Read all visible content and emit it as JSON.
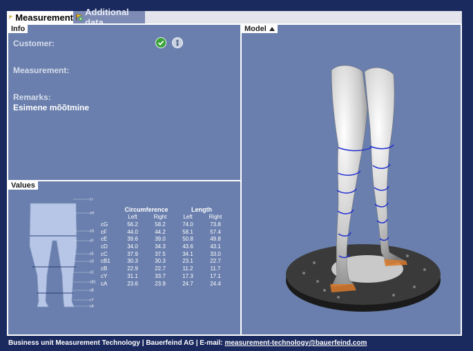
{
  "tabs": [
    {
      "label": "Measurement",
      "active": true,
      "icon": "flag-icon"
    },
    {
      "label": "Additional data",
      "active": false,
      "icon": "plus-icon"
    }
  ],
  "info": {
    "title": "Info",
    "customer_label": "Customer:",
    "measurement_label": "Measurement:",
    "remarks_label": "Remarks:",
    "remarks_value": "Esimene mõõtmine",
    "icons": [
      "check-icon",
      "person-icon"
    ]
  },
  "values": {
    "title": "Values",
    "circumference_label": "Circumference",
    "length_label": "Length",
    "col_left": "Left",
    "col_right": "Right",
    "rows": [
      {
        "m": "cG",
        "cl": "56.2",
        "cr": "58.2",
        "ll": "74.0",
        "lr": "73.8"
      },
      {
        "m": "cF",
        "cl": "44.0",
        "cr": "44.2",
        "ll": "58.1",
        "lr": "57.4"
      },
      {
        "m": "cE",
        "cl": "39.6",
        "cr": "39.0",
        "ll": "50.8",
        "lr": "49.8"
      },
      {
        "m": "cD",
        "cl": "34.0",
        "cr": "34.3",
        "ll": "43.6",
        "lr": "43.1"
      },
      {
        "m": "cC",
        "cl": "37.9",
        "cr": "37.5",
        "ll": "34.1",
        "lr": "33.0"
      },
      {
        "m": "cB1",
        "cl": "30.3",
        "cr": "30.3",
        "ll": "23.1",
        "lr": "22.7"
      },
      {
        "m": "cB",
        "cl": "22.9",
        "cr": "22.7",
        "ll": "11.2",
        "lr": "11.7"
      },
      {
        "m": "cY",
        "cl": "31.1",
        "cr": "33.7",
        "ll": "17.3",
        "lr": "17.1"
      },
      {
        "m": "cA",
        "cl": "23.6",
        "cr": "23.9",
        "ll": "24.7",
        "lr": "24.4"
      }
    ],
    "diagram_labels": [
      "cT",
      "cH",
      "cG",
      "cF",
      "cE",
      "cD",
      "cC",
      "cB1",
      "cB",
      "cY",
      "cA"
    ]
  },
  "model": {
    "title": "Model",
    "icon": "collapse-up-icon"
  },
  "footer": {
    "text": "Business unit Measurement Technology |  Bauerfeind AG |  E-mail: ",
    "email": "measurement-technology@bauerfeind.com"
  },
  "colors": {
    "background": "#1b2a5e",
    "panel": "#6a7fad",
    "scan_line": "#1f2fd0"
  }
}
